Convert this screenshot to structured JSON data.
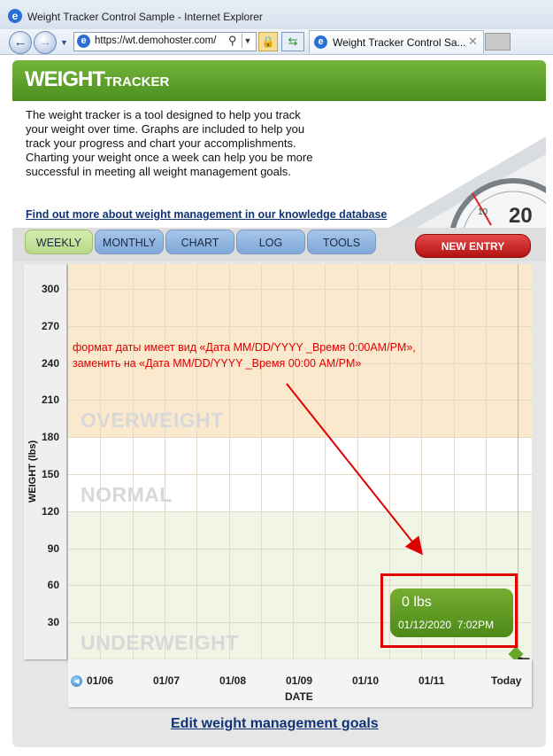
{
  "browser": {
    "window_title": "Weight Tracker Control Sample - Internet Explorer",
    "address_url": "https://wt.demohoster.com/",
    "tab_title": "Weight Tracker Control Sa..."
  },
  "header": {
    "logo_main": "WEIGHT",
    "logo_sub": "TRACKER"
  },
  "intro": {
    "text": "The weight tracker is a tool designed to help you track your weight over time. Graphs are included to help you track your progress and chart your accomplishments. Charting your weight once a week can help you be more successful in meeting all weight management goals.",
    "link": "Find out more about weight management in our knowledge database"
  },
  "tabs": [
    {
      "label": "WEEKLY",
      "active": true
    },
    {
      "label": "MONTHLY",
      "active": false
    },
    {
      "label": "CHART",
      "active": false
    },
    {
      "label": "LOG",
      "active": false
    },
    {
      "label": "TOOLS",
      "active": false
    }
  ],
  "new_entry_label": "NEW ENTRY",
  "chart_data": {
    "type": "line",
    "ylabel": "WEIGHT (lbs)",
    "xlabel": "DATE",
    "y_ticks": [
      "300",
      "270",
      "240",
      "210",
      "180",
      "150",
      "120",
      "90",
      "60",
      "30"
    ],
    "ylim": [
      0,
      320
    ],
    "categories": [
      "01/06",
      "01/07",
      "01/08",
      "01/09",
      "01/10",
      "01/11",
      "Today"
    ],
    "zones": [
      {
        "label": "OVERWEIGHT",
        "from": 180,
        "to": 320,
        "color": "#fbe9cd"
      },
      {
        "label": "NORMAL",
        "from": 120,
        "to": 180,
        "color": "#ffffff"
      },
      {
        "label": "UNDERWEIGHT",
        "from": 0,
        "to": 120,
        "color": "#f1f5e6"
      }
    ],
    "series": [
      {
        "x": "Today",
        "values": [
          0
        ]
      }
    ],
    "grid": true
  },
  "tooltip": {
    "weight": "0 lbs",
    "date": "01/12/2020",
    "time": "7:02PM"
  },
  "annotation": {
    "line1": "формат даты имеет вид «Дата MM/DD/YYYY _Время 0:00AM/PM»,",
    "line2": "заменить на «Дата MM/DD/YYYY _Время 00:00 AM/PM»"
  },
  "edit_goals_link": "Edit weight management goals",
  "colors": {
    "accent_green": "#5fa12a",
    "annotation_red": "#e00000",
    "tab_blue": "#8fb3df",
    "new_entry_red": "#c81e1e"
  }
}
